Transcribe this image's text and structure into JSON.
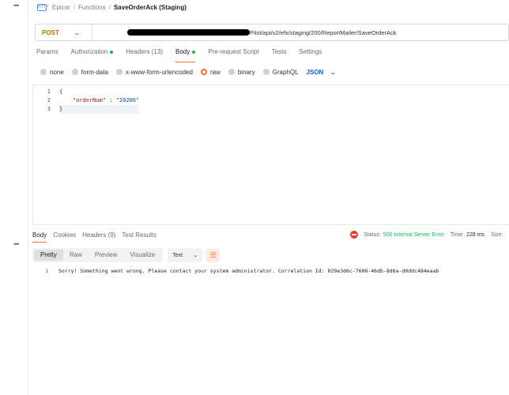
{
  "breadcrumb": {
    "items": [
      "Epicor",
      "Functions"
    ],
    "current": "SaveOrderAck (Staging)",
    "separator": "/"
  },
  "request": {
    "method": "POST",
    "url_visible": "Pilot/api/v2/efx/staging/200/ReportMailer/SaveOrderAck"
  },
  "request_tabs": [
    {
      "label": "Params"
    },
    {
      "label": "Authorization",
      "dot": true
    },
    {
      "label": "Headers",
      "count": "(13)"
    },
    {
      "label": "Body",
      "dot": true,
      "active": true
    },
    {
      "label": "Pre-request Script"
    },
    {
      "label": "Tests"
    },
    {
      "label": "Settings"
    }
  ],
  "body_options": {
    "none": "none",
    "form_data": "form-data",
    "urlencoded": "x-www-form-urlencoded",
    "raw": "raw",
    "binary": "binary",
    "graphql": "GraphQL",
    "format": "JSON"
  },
  "editor": {
    "line_numbers": [
      "1",
      "2",
      "3"
    ],
    "open_brace": "{",
    "key": "\"orderNum\"",
    "colon": " : ",
    "value": "\"20206\"",
    "close_brace": "}"
  },
  "response_tabs": {
    "body": "Body",
    "cookies": "Cookies",
    "headers": "Headers",
    "headers_count": "(9)",
    "test_results": "Test Results"
  },
  "response_status": {
    "status_label": "Status:",
    "status_value": "500 Internal Server Error",
    "time_label": "Time:",
    "time_value": "228 ms",
    "size_label": "Size:"
  },
  "response_toolbar": {
    "pretty": "Pretty",
    "raw": "Raw",
    "preview": "Preview",
    "visualize": "Visualize",
    "format": "Text"
  },
  "response_body": {
    "line_number": "1",
    "text": "Sorry! Something went wrong. Please contact your system administrator. Correlation Id: 029e3d6c-7608-46db-8d6a-d0ddc484eaab"
  },
  "colors": {
    "accent": "#ff6c37",
    "method": "#b37400",
    "success": "#0cbb52",
    "json": "#0b62c7",
    "error": "#e0402c"
  }
}
